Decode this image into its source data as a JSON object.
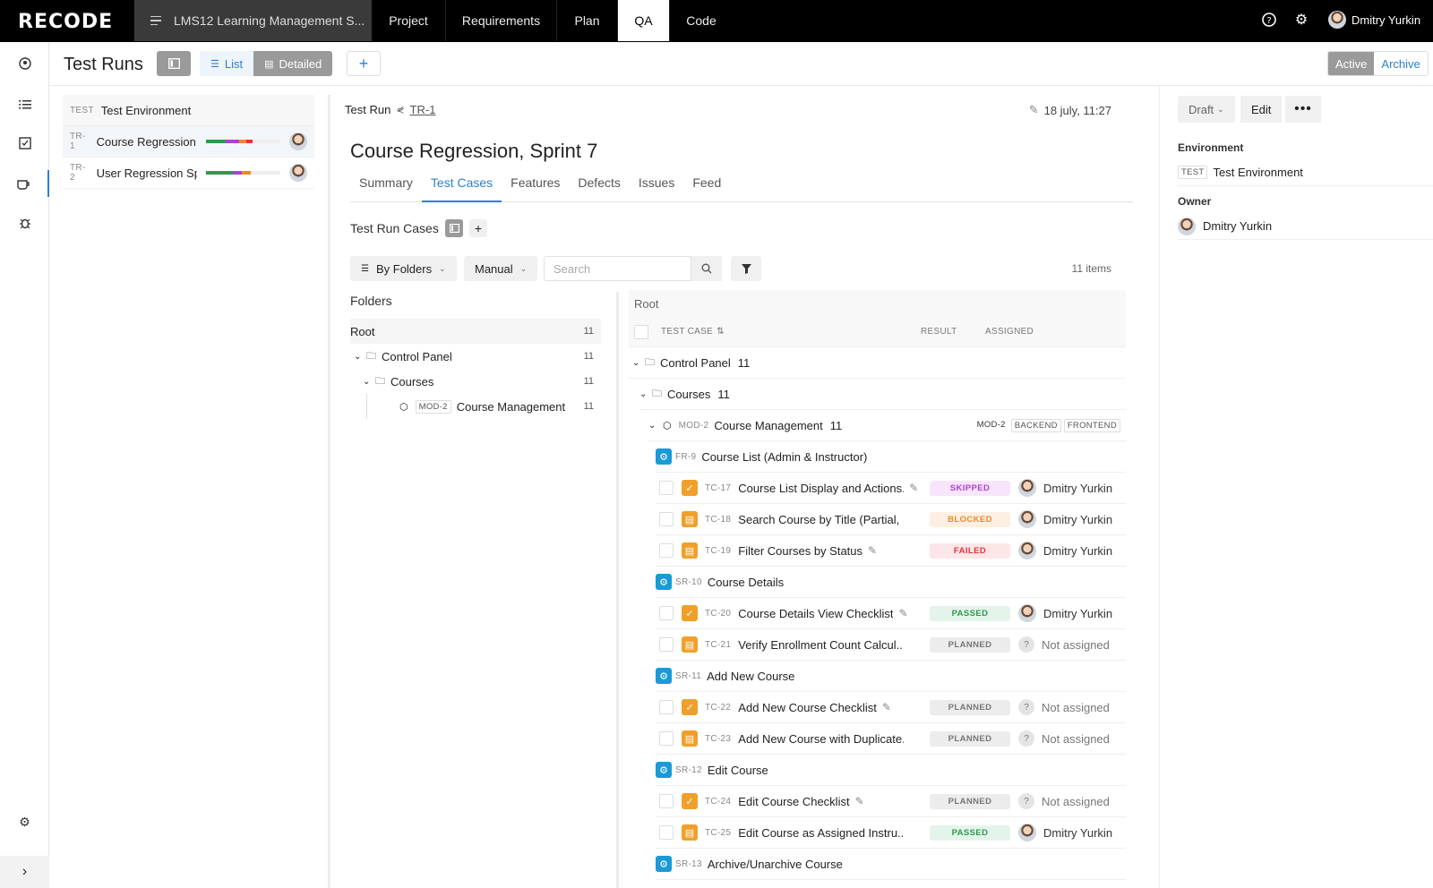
{
  "topbar": {
    "logo": "RECODE",
    "project": "LMS12 Learning Management S...",
    "tabs": [
      "Project",
      "Requirements",
      "Plan",
      "QA",
      "Code"
    ],
    "user": "Dmitry Yurkin"
  },
  "header": {
    "title": "Test Runs",
    "view_list": "List",
    "view_detailed": "Detailed",
    "active": "Active",
    "archive": "Archive"
  },
  "runs": {
    "env_code": "TEST",
    "env_name": "Test Environment",
    "items": [
      {
        "code": "TR-1",
        "name": "Course Regression,..."
      },
      {
        "code": "TR-2",
        "name": "User Regression Sp..."
      }
    ]
  },
  "detail": {
    "label": "Test Run",
    "code": "TR-1",
    "date": "18 july, 11:27",
    "title": "Course Regression, Sprint 7",
    "tabs": [
      "Summary",
      "Test Cases",
      "Features",
      "Defects",
      "Issues",
      "Feed"
    ],
    "section": "Test Run Cases",
    "group_by": "By Folders",
    "mode": "Manual",
    "search_placeholder": "Search",
    "count": "11 items"
  },
  "folders": {
    "title": "Folders",
    "root": "Root",
    "root_count": "11",
    "control_panel": "Control Panel",
    "cp_count": "11",
    "courses": "Courses",
    "courses_count": "11",
    "module_code": "MOD-2",
    "module": "Course Management",
    "module_count": "11"
  },
  "tree": {
    "root": "Root",
    "col_case": "TEST CASE",
    "col_result": "RESULT",
    "col_assigned": "ASSIGNED",
    "cp": "Control Panel",
    "cp_count": "11",
    "courses": "Courses",
    "courses_count": "11",
    "mod_code": "MOD-2",
    "mod_name": "Course Management",
    "mod_count": "11",
    "mod_tags": [
      "MOD-2",
      "BACKEND",
      "FRONTEND"
    ],
    "groups": [
      {
        "code": "FR-9",
        "name": "Course List (Admin & Instructor)",
        "cases": [
          {
            "code": "TC-17",
            "name": "Course List Display and Actions...",
            "result": "SKIPPED",
            "assignee": "Dmitry Yurkin"
          },
          {
            "code": "TC-18",
            "name": "Search Course by Title (Partial, ...",
            "result": "BLOCKED",
            "assignee": "Dmitry Yurkin"
          },
          {
            "code": "TC-19",
            "name": "Filter Courses by Status",
            "result": "FAILED",
            "assignee": "Dmitry Yurkin"
          }
        ]
      },
      {
        "code": "SR-10",
        "name": "Course Details",
        "cases": [
          {
            "code": "TC-20",
            "name": "Course Details View Checklist",
            "result": "PASSED",
            "assignee": "Dmitry Yurkin"
          },
          {
            "code": "TC-21",
            "name": "Verify Enrollment Count Calcul...",
            "result": "PLANNED",
            "assignee": "Not assigned"
          }
        ]
      },
      {
        "code": "SR-11",
        "name": "Add New Course",
        "cases": [
          {
            "code": "TC-22",
            "name": "Add New Course Checklist",
            "result": "PLANNED",
            "assignee": "Not assigned"
          },
          {
            "code": "TC-23",
            "name": "Add New Course with Duplicate...",
            "result": "PLANNED",
            "assignee": "Not assigned"
          }
        ]
      },
      {
        "code": "SR-12",
        "name": "Edit Course",
        "cases": [
          {
            "code": "TC-24",
            "name": "Edit Course Checklist",
            "result": "PLANNED",
            "assignee": "Not assigned"
          },
          {
            "code": "TC-25",
            "name": "Edit Course as Assigned Instru...",
            "result": "PASSED",
            "assignee": "Dmitry Yurkin"
          }
        ]
      },
      {
        "code": "SR-13",
        "name": "Archive/Unarchive Course",
        "cases": []
      }
    ]
  },
  "panel": {
    "status": "Draft",
    "edit": "Edit",
    "env_label": "Environment",
    "env_code": "TEST",
    "env_name": "Test Environment",
    "owner_label": "Owner",
    "owner": "Dmitry Yurkin"
  },
  "colors": {
    "accent": "#2a7fd6",
    "skipped": "#b03fd6",
    "blocked": "#e88a2a",
    "failed": "#e0343a",
    "passed": "#2c9a4e",
    "planned": "#777777"
  }
}
